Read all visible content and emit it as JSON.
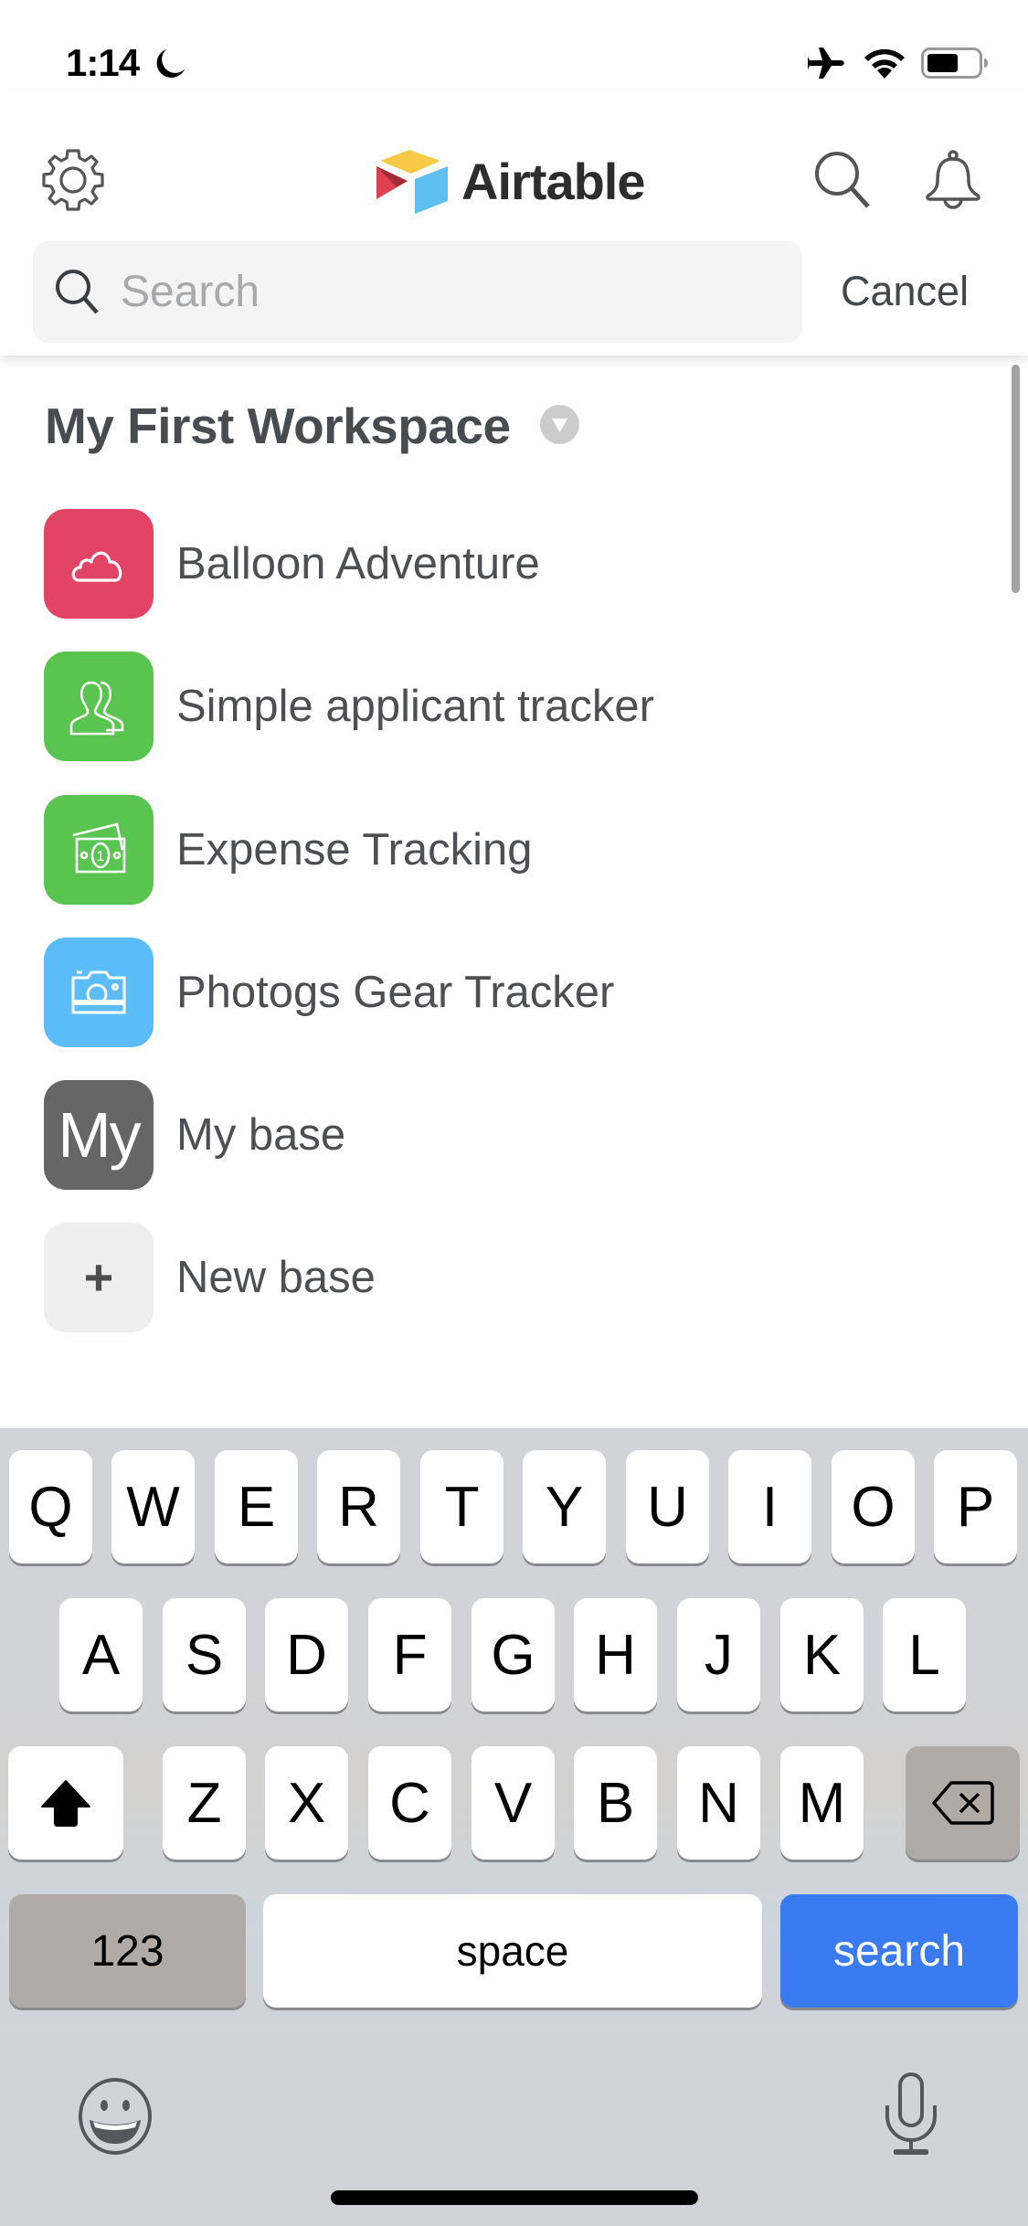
{
  "status_bar": {
    "time": "1:14",
    "icons": [
      "moon-icon",
      "airplane-icon",
      "wifi-icon",
      "battery-icon"
    ],
    "battery_level": 0.6
  },
  "header": {
    "logo_text": "Airtable",
    "settings_icon": "gear-icon",
    "search_icon": "search-icon",
    "notifications_icon": "bell-icon",
    "search": {
      "placeholder": "Search",
      "value": ""
    },
    "cancel_label": "Cancel"
  },
  "workspace": {
    "title": "My First Workspace",
    "dropdown_icon": "chevron-down-circle-icon",
    "bases": [
      {
        "name": "Balloon Adventure",
        "icon": "cloud-icon",
        "color": "#e34465"
      },
      {
        "name": "Simple applicant tracker",
        "icon": "users-icon",
        "color": "#5ac450"
      },
      {
        "name": "Expense Tracking",
        "icon": "money-icon",
        "color": "#5ac450"
      },
      {
        "name": "Photogs Gear Tracker",
        "icon": "camera-icon",
        "color": "#5bbcf9"
      },
      {
        "name": "My base",
        "icon": "initials",
        "initials": "My",
        "color": "#666666"
      }
    ],
    "new_base": {
      "name": "New base",
      "icon": "plus-icon",
      "color": "#eeeeee"
    }
  },
  "keyboard": {
    "rows": [
      [
        "Q",
        "W",
        "E",
        "R",
        "T",
        "Y",
        "U",
        "I",
        "O",
        "P"
      ],
      [
        "A",
        "S",
        "D",
        "F",
        "G",
        "H",
        "J",
        "K",
        "L"
      ],
      [
        "Z",
        "X",
        "C",
        "V",
        "B",
        "N",
        "M"
      ]
    ],
    "shift_icon": "shift-icon",
    "delete_icon": "delete-icon",
    "numbers_label": "123",
    "space_label": "space",
    "return_label": "search",
    "emoji_icon": "emoji-icon",
    "mic_icon": "microphone-icon",
    "accent_color": "#3a7bf2"
  }
}
